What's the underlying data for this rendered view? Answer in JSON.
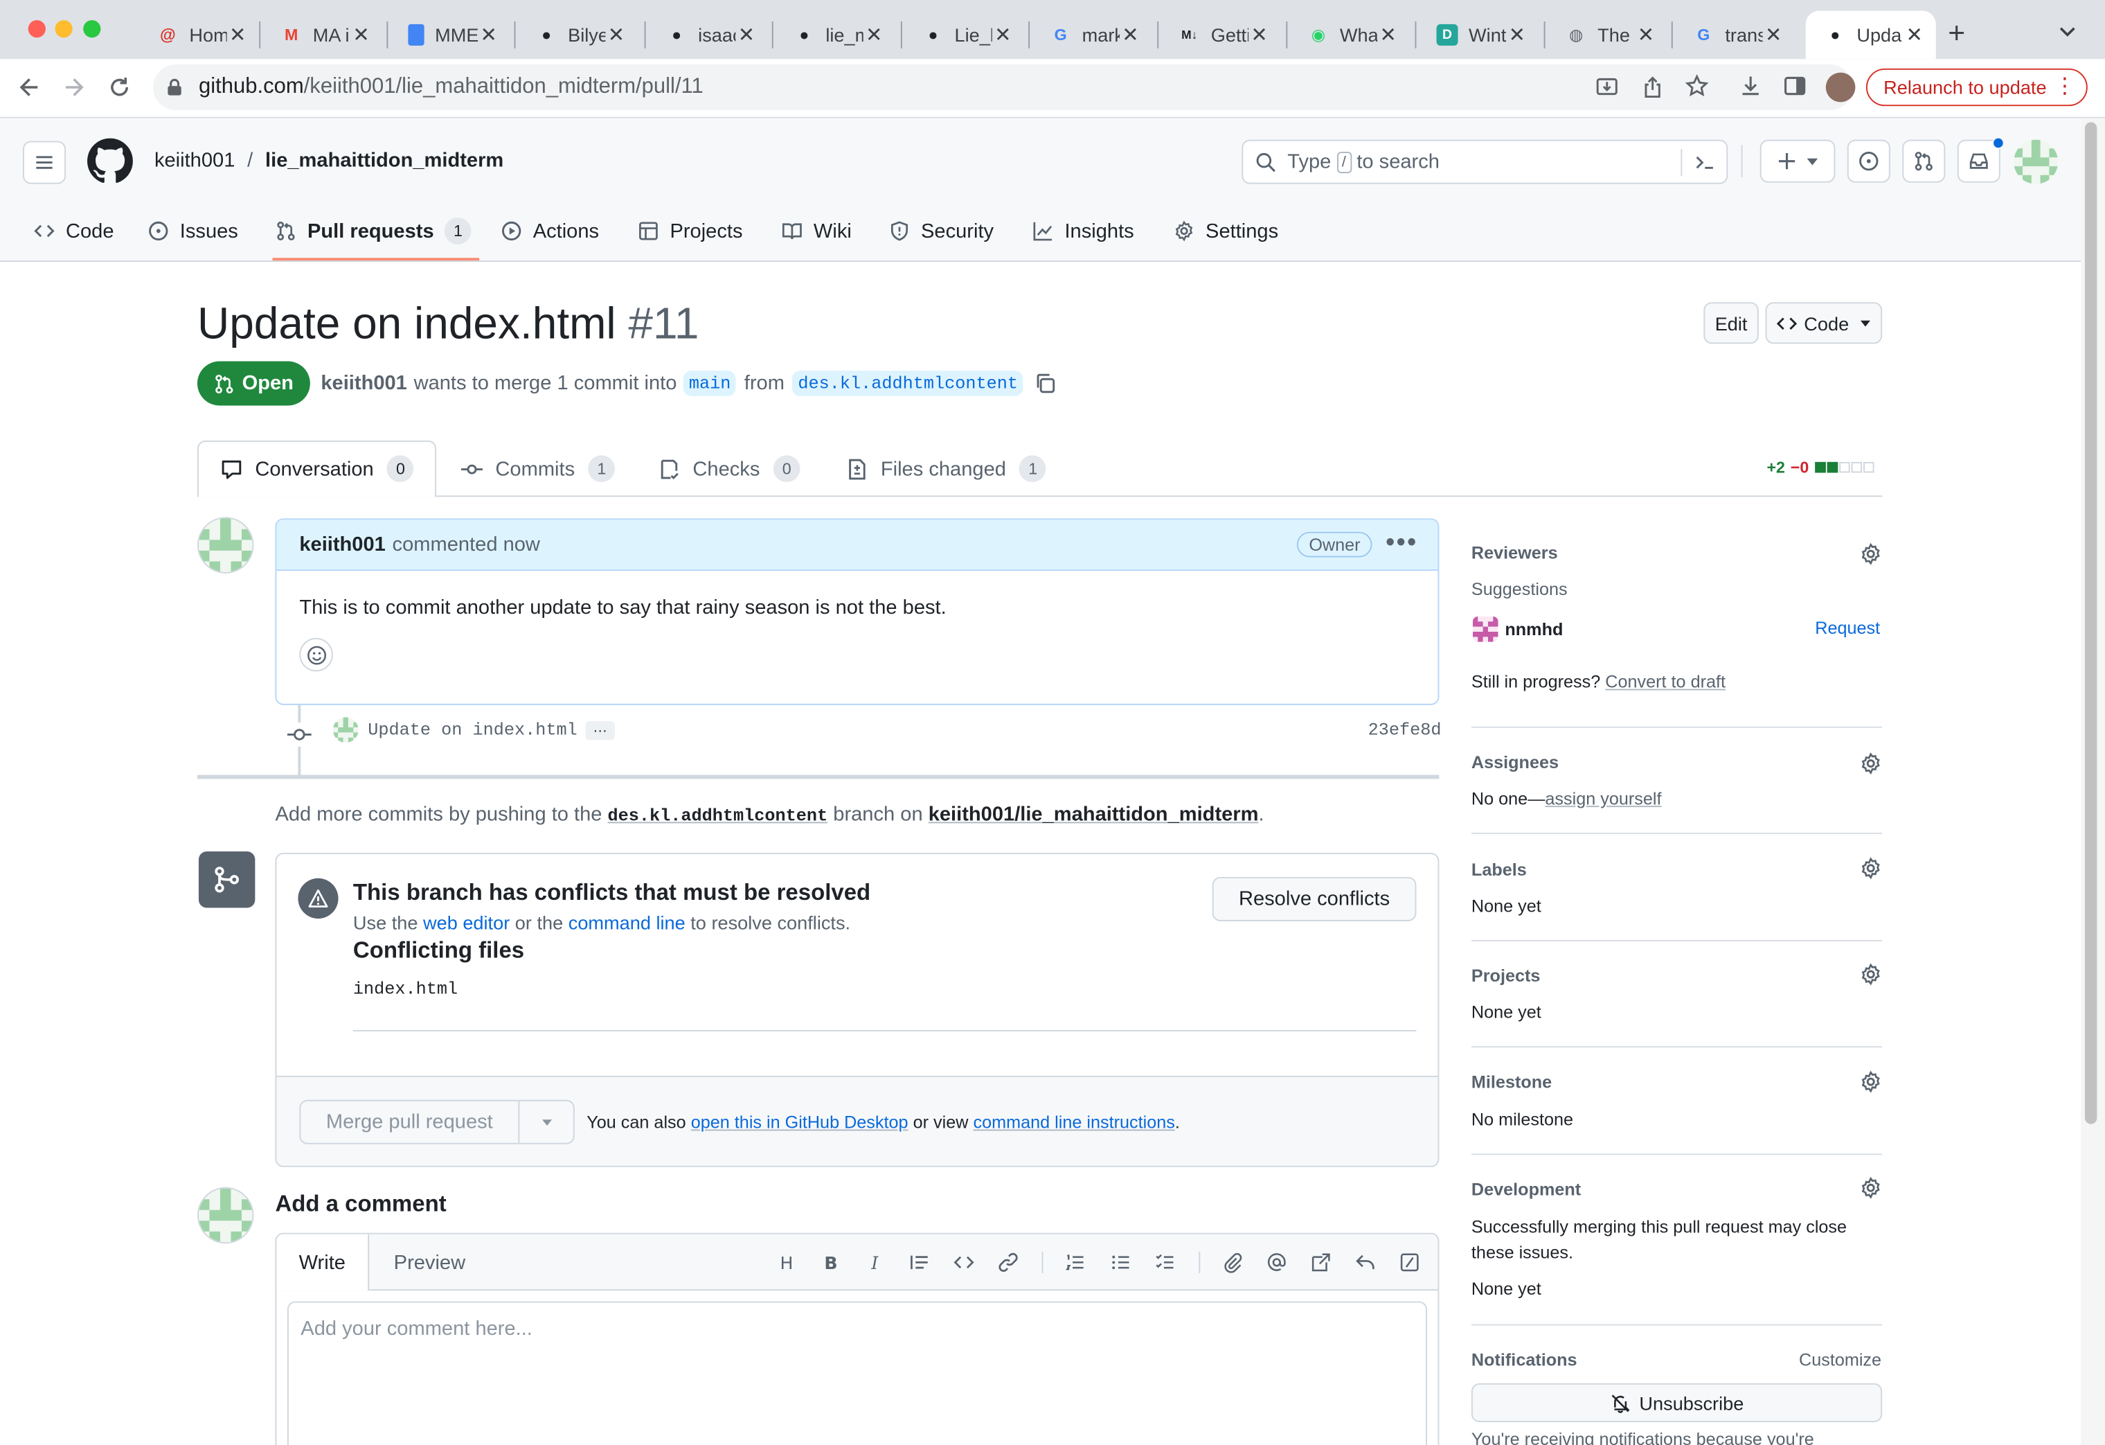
{
  "browser": {
    "tabs": [
      {
        "title": "Home",
        "icon": "at-icon",
        "color": "#d93025"
      },
      {
        "title": "MA in",
        "icon": "gmail-icon",
        "color": "#ea4335"
      },
      {
        "title": "MME",
        "icon": "docs-icon",
        "color": "#4285f4"
      },
      {
        "title": "Bilye",
        "icon": "github-icon",
        "color": "#1f2328"
      },
      {
        "title": "isaac",
        "icon": "github-icon",
        "color": "#1f2328"
      },
      {
        "title": "lie_m",
        "icon": "github-icon",
        "color": "#1f2328"
      },
      {
        "title": "Lie_k",
        "icon": "github-icon",
        "color": "#1f2328"
      },
      {
        "title": "mark",
        "icon": "google-icon",
        "color": "#4285f4"
      },
      {
        "title": "Getti",
        "icon": "markdown-icon",
        "color": "#1f2328"
      },
      {
        "title": "What",
        "icon": "whatsapp-icon",
        "color": "#25d366"
      },
      {
        "title": "Wint",
        "icon": "d-icon",
        "color": "#26a69a"
      },
      {
        "title": "The",
        "icon": "globe-icon",
        "color": "#5f6368"
      },
      {
        "title": "trans",
        "icon": "google-icon",
        "color": "#4285f4"
      },
      {
        "title": "Upda",
        "icon": "github-icon",
        "color": "#1f2328"
      }
    ],
    "url_host": "github.com",
    "url_path": "/keiith001/lie_mahaittidon_midterm/pull/11",
    "relaunch_label": "Relaunch to update"
  },
  "header": {
    "owner": "keiith001",
    "separator": "/",
    "repo": "lie_mahaittidon_midterm",
    "search_prefix": "Type",
    "search_key": "/",
    "search_suffix": "to search"
  },
  "repo_nav": [
    {
      "label": "Code",
      "icon": "code-icon"
    },
    {
      "label": "Issues",
      "icon": "issue-icon"
    },
    {
      "label": "Pull requests",
      "icon": "pull-request-icon",
      "count": "1"
    },
    {
      "label": "Actions",
      "icon": "play-icon"
    },
    {
      "label": "Projects",
      "icon": "table-icon"
    },
    {
      "label": "Wiki",
      "icon": "book-icon"
    },
    {
      "label": "Security",
      "icon": "shield-icon"
    },
    {
      "label": "Insights",
      "icon": "graph-icon"
    },
    {
      "label": "Settings",
      "icon": "gear-icon"
    }
  ],
  "pr": {
    "title": "Update on index.html",
    "number": "#11",
    "edit_label": "Edit",
    "code_label": "Code",
    "state": "Open",
    "author": "keiith001",
    "merge_text": "wants to merge 1 commit into",
    "base": "main",
    "from_text": "from",
    "head": "des.kl.addhtmlcontent"
  },
  "pr_tabs": [
    {
      "label": "Conversation",
      "count": "0",
      "icon": "comment-icon"
    },
    {
      "label": "Commits",
      "count": "1",
      "icon": "commit-icon"
    },
    {
      "label": "Checks",
      "count": "0",
      "icon": "checklist-icon"
    },
    {
      "label": "Files changed",
      "count": "1",
      "icon": "file-diff-icon"
    }
  ],
  "diffstat": {
    "added": "+2",
    "removed": "−0",
    "blocks": [
      "#1a7f37",
      "#1a7f37",
      "#d0d7de",
      "#d0d7de",
      "#d0d7de"
    ]
  },
  "comment": {
    "author": "keiith001",
    "action": "commented now",
    "badge": "Owner",
    "body": "This is to commit another update to say that rainy season is not the best."
  },
  "commit": {
    "message": "Update on index.html",
    "sha": "23efe8d",
    "ellipsis": "…"
  },
  "push_hint": {
    "prefix": "Add more commits by pushing to the",
    "branch": "des.kl.addhtmlcontent",
    "middle": "branch on",
    "repo": "keiith001/lie_mahaittidon_midterm",
    "suffix": "."
  },
  "conflicts": {
    "title": "This branch has conflicts that must be resolved",
    "use_the": "Use the",
    "web_editor": "web editor",
    "or_the": "or the",
    "command_line": "command line",
    "to_resolve": "to resolve conflicts.",
    "files_title": "Conflicting files",
    "file": "index.html",
    "resolve_label": "Resolve conflicts"
  },
  "merge": {
    "button_label": "Merge pull request",
    "also": "You can also",
    "desktop_link": "open this in GitHub Desktop",
    "or_view": "or view",
    "cli_link": "command line instructions",
    "period": "."
  },
  "add_comment": {
    "title": "Add a comment",
    "write_tab": "Write",
    "preview_tab": "Preview",
    "placeholder": "Add your comment here..."
  },
  "sidebar": {
    "reviewers_title": "Reviewers",
    "suggestions_label": "Suggestions",
    "suggested_reviewer": "nnmhd",
    "request_label": "Request",
    "draft_prefix": "Still in progress?",
    "draft_link": "Convert to draft",
    "assignees_title": "Assignees",
    "assignees_none": "No one—",
    "assign_yourself": "assign yourself",
    "labels_title": "Labels",
    "labels_value": "None yet",
    "projects_title": "Projects",
    "projects_value": "None yet",
    "milestone_title": "Milestone",
    "milestone_value": "No milestone",
    "development_title": "Development",
    "development_text": "Successfully merging this pull request may close these issues.",
    "development_value": "None yet",
    "notifications_title": "Notifications",
    "customize_label": "Customize",
    "unsubscribe_label": "Unsubscribe",
    "receiving_text": "You're receiving notifications because you're"
  }
}
